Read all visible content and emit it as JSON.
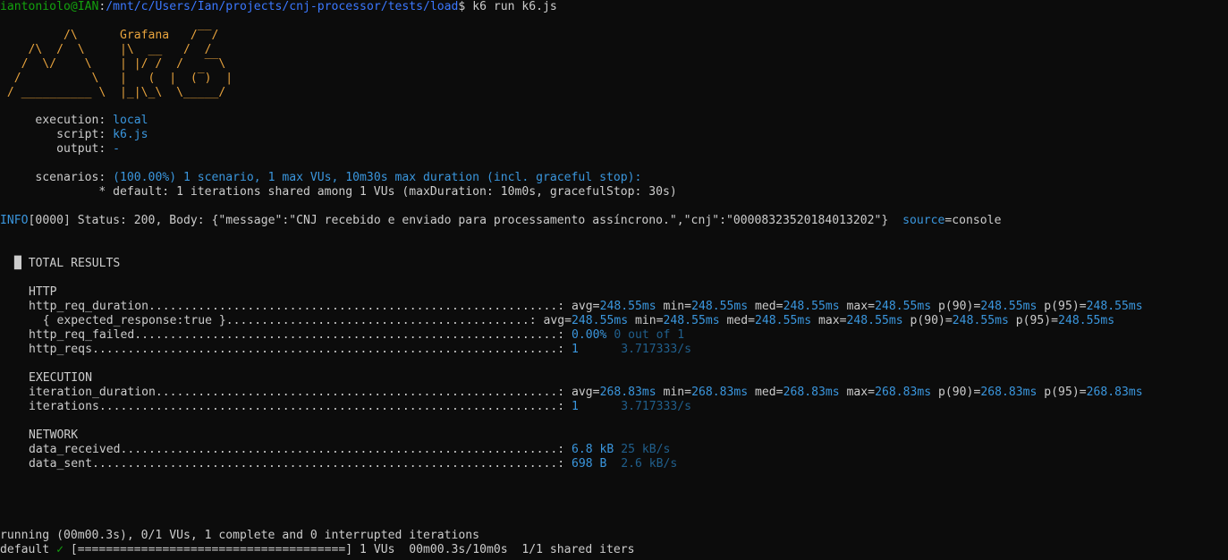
{
  "prompt": {
    "user_host": "iantoniolo@IAN",
    "sep": ":",
    "path": "/mnt/c/Users/Ian/projects/cnj-processor/tests/load",
    "symbol": "$",
    "command": " k6 run k6.js"
  },
  "logo": [
    "         /\\      Grafana   /‾‾/",
    "    /\\  /  \\     |\\  __   /  /",
    "   /  \\/    \\    | |/ /  /   ‾‾\\",
    "  /          \\   |   (  |  (‾)  |",
    " / __________ \\  |_|\\_\\  \\_____/"
  ],
  "options": [
    {
      "label": "     execution: ",
      "value": "local"
    },
    {
      "label": "        script: ",
      "value": "k6.js"
    },
    {
      "label": "        output: ",
      "value": "-"
    }
  ],
  "scenarios": {
    "label": "     scenarios: ",
    "value": "(100.00%) 1 scenario, 1 max VUs, 10m30s max duration (incl. graceful stop):",
    "detail": "              * default: 1 iterations shared among 1 VUs (maxDuration: 10m0s, gracefulStop: 30s)"
  },
  "info": {
    "level": "INFO",
    "text": "[0000] Status: 200, Body: {\"message\":\"CNJ recebido e enviado para processamento assíncrono.\",\"cnj\":\"00008323520184013202\"}  ",
    "source_key": "source",
    "source_eq": "=",
    "source_val": "console"
  },
  "results": {
    "block": "█",
    "title": " TOTAL RESULTS",
    "sections": {
      "http": {
        "heading": "HTTP",
        "rows": [
          {
            "name": "http_req_duration",
            "dots": "..........................................................: ",
            "parts": [
              "avg=",
              "248.55ms",
              " min=",
              "248.55ms",
              " med=",
              "248.55ms",
              " max=",
              "248.55ms",
              " p(90)=",
              "248.55ms",
              " p(95)=",
              "248.55ms"
            ]
          },
          {
            "name": "  { expected_response:true }",
            "dots": "...........................................: ",
            "parts": [
              "avg=",
              "248.55ms",
              " min=",
              "248.55ms",
              " med=",
              "248.55ms",
              " max=",
              "248.55ms",
              " p(90)=",
              "248.55ms",
              " p(95)=",
              "248.55ms"
            ]
          },
          {
            "name": "http_req_failed",
            "dots": "............................................................: ",
            "value": "0.00% ",
            "extra": "0 out of 1"
          },
          {
            "name": "http_reqs",
            "dots": "..................................................................: ",
            "value": "1      ",
            "extra": "3.717333/s"
          }
        ]
      },
      "execution": {
        "heading": "EXECUTION",
        "rows": [
          {
            "name": "iteration_duration",
            "dots": ".........................................................: ",
            "parts": [
              "avg=",
              "268.83ms",
              " min=",
              "268.83ms",
              " med=",
              "268.83ms",
              " max=",
              "268.83ms",
              " p(90)=",
              "268.83ms",
              " p(95)=",
              "268.83ms"
            ]
          },
          {
            "name": "iterations",
            "dots": ".................................................................: ",
            "value": "1      ",
            "extra": "3.717333/s"
          }
        ]
      },
      "network": {
        "heading": "NETWORK",
        "rows": [
          {
            "name": "data_received",
            "dots": "..............................................................: ",
            "value": "6.8 kB ",
            "extra": "25 kB/s"
          },
          {
            "name": "data_sent",
            "dots": "..................................................................: ",
            "value": "698 B  ",
            "extra": "2.6 kB/s"
          }
        ]
      }
    }
  },
  "footer": {
    "running": "running (00m00.3s), 0/1 VUs, 1 complete and 0 interrupted iterations",
    "default_label": "default ",
    "check": "✓",
    "progress": " [======================================] 1 VUs  00m00.3s/10m0s  1/1 shared iters"
  },
  "colors": {
    "background": "#0c0c0c",
    "text": "#cccccc",
    "prompt_user": "#13a10e",
    "prompt_path": "#3b78ff",
    "logo": "#e8a33d",
    "value": "#3a96dd",
    "value_dim": "#205f8c"
  }
}
